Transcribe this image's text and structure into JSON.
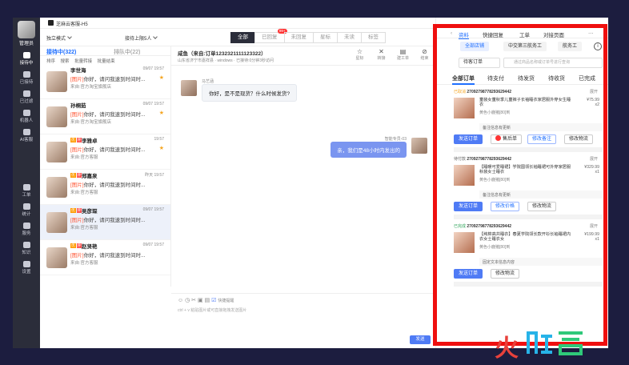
{
  "rail": {
    "role": "管理员",
    "items": [
      {
        "label": "接待中",
        "icon": "chat-bubble-icon",
        "active": true
      },
      {
        "label": "已接待",
        "icon": "history-icon"
      },
      {
        "label": "已过滤",
        "icon": "filter-icon"
      },
      {
        "label": "机器人",
        "icon": "robot-icon"
      },
      {
        "label": "AI客服",
        "icon": "ai-icon"
      },
      {
        "label": "工单",
        "icon": "ticket-icon"
      },
      {
        "label": "统计",
        "icon": "stats-icon"
      },
      {
        "label": "服务",
        "icon": "service-icon"
      },
      {
        "label": "知识",
        "icon": "knowledge-icon"
      },
      {
        "label": "设置",
        "icon": "settings-icon"
      }
    ]
  },
  "topbar": {
    "title": "芝麻云客服-H5"
  },
  "filter": {
    "mode": "独立模式",
    "assignee": "接待上限5人",
    "tabs": [
      {
        "label": "全部",
        "active": true
      },
      {
        "label": "已回复",
        "badge": "99+"
      },
      {
        "label": "未回复"
      },
      {
        "label": "星标"
      },
      {
        "label": "未读"
      },
      {
        "label": "标签"
      }
    ]
  },
  "list": {
    "tab_active": "接待中(322)",
    "tab_other": "排队中(22)",
    "tools": [
      "排序",
      "搜索",
      "批量转接",
      "批量结束"
    ],
    "items": [
      {
        "name": "李世海",
        "time": "09/07 19:57",
        "prefix": "[图片]",
        "message": "你好，请问我速到时间时...",
        "source": "来自:官方淘宝旗舰店",
        "star": true,
        "tags": []
      },
      {
        "name": "孙桐茹",
        "time": "09/07 19:57",
        "prefix": "[图片]",
        "message": "你好，请问我速到时间时...",
        "source": "来自:官方淘宝旗舰店",
        "star": true,
        "tags": []
      },
      {
        "name": "李雅卓",
        "time": "19:57",
        "prefix": "[图片]",
        "message": "你好，请问我速到时间时...",
        "source": "来自:官方客服",
        "star": true,
        "tags": [
          "优",
          "评"
        ]
      },
      {
        "name": "郑嘉泉",
        "time": "昨天 19:57",
        "prefix": "[图片]",
        "message": "你好，请问我速到时间时...",
        "source": "来自:官方客服",
        "star": false,
        "tags": [
          "优",
          "评"
        ]
      },
      {
        "name": "吴彦琛",
        "time": "09/07 19:57",
        "prefix": "[图片]",
        "message": "你好，请问我速到时间时...",
        "source": "来自:官方客服",
        "star": false,
        "tags": [
          "优",
          "评"
        ]
      },
      {
        "name": "赵贤艳",
        "time": "09/07 19:57",
        "prefix": "[图片]",
        "message": "你好，请问我速到时间时...",
        "source": "来自:官方客服",
        "star": false,
        "tags": [
          "优",
          "评"
        ]
      }
    ]
  },
  "chat": {
    "title": "咸鱼（来自:订单1232321111123322）",
    "meta": "山东省济宁市嘉祥县 · windows · 已接待:0分钟3秒访问",
    "tools": [
      {
        "label": "星标",
        "glyph": "☆"
      },
      {
        "label": "转接",
        "glyph": "✕"
      },
      {
        "label": "建工单",
        "glyph": "▤"
      },
      {
        "label": "结束",
        "glyph": "⊘"
      }
    ],
    "incoming": {
      "from": "马艺涵",
      "text": "你好，是不是现货？什么时候发货?"
    },
    "outgoing": {
      "from": "智能专员-03",
      "text": "亲，我们是48小时内发出的"
    },
    "composer_hint": "ctrl + v 粘贴图片或可直接拖拽发送图片",
    "send_label": "发送",
    "composer_toggle": "快捷提醒"
  },
  "panel": {
    "tabs": [
      {
        "label": "资料",
        "active": true
      },
      {
        "label": "快捷回复"
      },
      {
        "label": "工单"
      },
      {
        "label": "对接页面"
      }
    ],
    "more": "···",
    "chips": [
      {
        "label": "全部店铺",
        "active": true
      },
      {
        "label": "中交第三航务工",
        "active": false
      },
      {
        "label": "航务工",
        "active": false
      }
    ],
    "status_select": "待客订单",
    "search_placeholder": "通过商品名称或订单号进行查询",
    "order_tabs": [
      {
        "label": "全部订单",
        "active": true
      },
      {
        "label": "待支付"
      },
      {
        "label": "待发货"
      },
      {
        "label": "待收货"
      },
      {
        "label": "已完成"
      }
    ],
    "orders": [
      {
        "status": "已取消",
        "number": "27092798778293629442",
        "fold": "展开",
        "title": "童装女童秋季儿童裤子长袖睡衣家居服外穿女生睡衣",
        "spec": "黄色小鹿猪[80]到",
        "price": "¥75.99",
        "qty": "x2",
        "note": "备注信息有更新",
        "buttons": [
          "发送订单",
          "售后单",
          "修改备注",
          "修改物流"
        ]
      },
      {
        "status": "待付款",
        "number": "27092798778293629442",
        "fold": "展开",
        "title": "【睡暖可爱睡裙】学院圆领长袖睡裙可外穿家居服秋装女士睡衣",
        "spec": "黄色小鹿猪[80]到",
        "price": "¥329.99",
        "qty": "x1",
        "note": "备注信息有更新",
        "buttons": [
          "发送订单",
          "修改价格",
          "修改物流"
        ]
      },
      {
        "status": "已完成",
        "number": "27092798778293629442",
        "fold": "展开",
        "title": "【纯棉高共睡衣】春夏学院领长款开衫长袖睡裙内衣女士睡衣女",
        "spec": "黄色小鹿猪[80]到",
        "price": "¥199.99",
        "qty": "x1",
        "note": "固定文本信息内容",
        "buttons": [
          "发送订单",
          "修改物流"
        ]
      }
    ]
  },
  "watermark": {
    "text": "火鲤鱼"
  }
}
